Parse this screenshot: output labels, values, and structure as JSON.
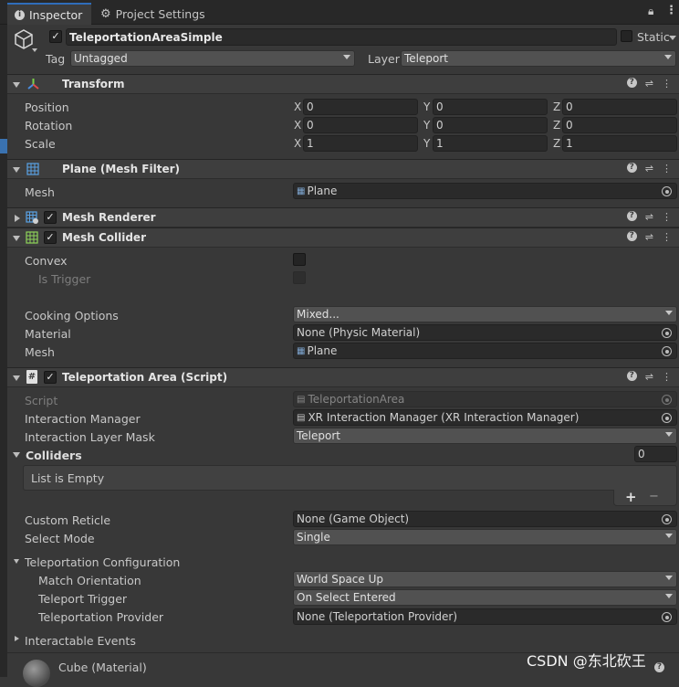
{
  "tabs": {
    "inspector": "Inspector",
    "project_settings": "Project Settings"
  },
  "object": {
    "name": "TeleportationAreaSimple",
    "static_label": "Static",
    "tag_label": "Tag",
    "tag_value": "Untagged",
    "layer_label": "Layer",
    "layer_value": "Teleport"
  },
  "transform": {
    "title": "Transform",
    "position": "Position",
    "rotation": "Rotation",
    "scale": "Scale",
    "x": "X",
    "y": "Y",
    "z": "Z",
    "pos": [
      "0",
      "0",
      "0"
    ],
    "rot": [
      "0",
      "0",
      "0"
    ],
    "scl": [
      "1",
      "1",
      "1"
    ]
  },
  "mesh_filter": {
    "title": "Plane (Mesh Filter)",
    "mesh_label": "Mesh",
    "mesh_value": "Plane"
  },
  "mesh_renderer": {
    "title": "Mesh Renderer"
  },
  "mesh_collider": {
    "title": "Mesh Collider",
    "convex": "Convex",
    "is_trigger": "Is Trigger",
    "cooking": "Cooking Options",
    "cooking_value": "Mixed...",
    "material": "Material",
    "material_value": "None (Physic Material)",
    "mesh": "Mesh",
    "mesh_value": "Plane"
  },
  "teleport": {
    "title": "Teleportation Area (Script)",
    "script": "Script",
    "script_value": "TeleportationArea",
    "im": "Interaction Manager",
    "im_value": "XR Interaction Manager (XR Interaction Manager)",
    "mask": "Interaction Layer Mask",
    "mask_value": "Teleport",
    "colliders": "Colliders",
    "colliders_count": "0",
    "list_empty": "List is Empty",
    "plus": "+",
    "minus": "−",
    "reticle": "Custom Reticle",
    "reticle_value": "None (Game Object)",
    "select_mode": "Select Mode",
    "select_mode_value": "Single",
    "config": "Teleportation Configuration",
    "match": "Match Orientation",
    "match_value": "World Space Up",
    "trigger": "Teleport Trigger",
    "trigger_value": "On Select Entered",
    "provider": "Teleportation Provider",
    "provider_value": "None (Teleportation Provider)",
    "events": "Interactable Events"
  },
  "material": {
    "name": "Cube (Material)"
  },
  "watermark": "CSDN @东北砍王",
  "colors": {
    "accent": "#2f6dba",
    "background": "#383838",
    "header": "#3e3e3e"
  }
}
